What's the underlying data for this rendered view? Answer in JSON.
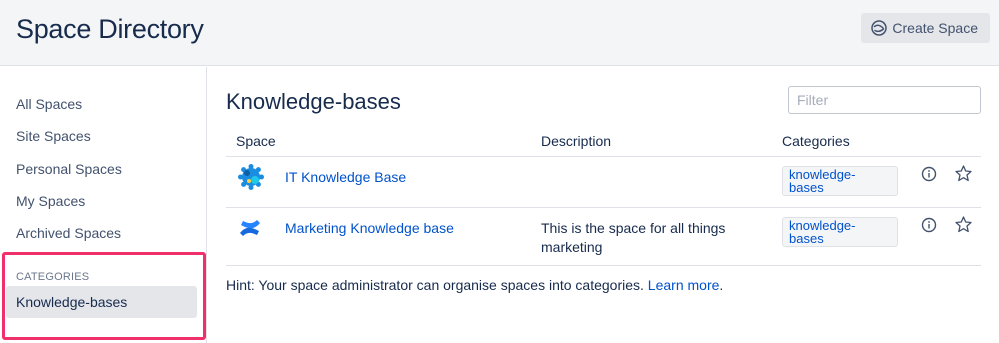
{
  "header": {
    "title": "Space Directory",
    "create_label": "Create Space"
  },
  "sidebar": {
    "items": [
      {
        "label": "All Spaces"
      },
      {
        "label": "Site Spaces"
      },
      {
        "label": "Personal Spaces"
      },
      {
        "label": "My Spaces"
      },
      {
        "label": "Archived Spaces"
      }
    ],
    "categories_heading": "CATEGORIES",
    "categories": [
      {
        "label": "Knowledge-bases",
        "selected": true
      }
    ]
  },
  "main": {
    "title": "Knowledge-bases",
    "filter_placeholder": "Filter",
    "columns": [
      "Space",
      "Description",
      "Categories"
    ],
    "rows": [
      {
        "icon": "it-knowledge-base-logo-icon",
        "name": "IT Knowledge Base",
        "description": "",
        "category_line1": "knowledge-",
        "category_line2": "bases"
      },
      {
        "icon": "confluence-logo-icon",
        "name": "Marketing Knowledge base",
        "description_line1": "This is the space for all things",
        "description_line2": "marketing",
        "category_line1": "knowledge-",
        "category_line2": "bases"
      }
    ],
    "hint_text": "Hint: Your space administrator can organise spaces into categories.",
    "hint_link": "Learn more",
    "hint_end": "."
  },
  "colors": {
    "accent": "#0052cc",
    "text": "#172b4d",
    "header_bg": "#f4f5f7",
    "selected_bg": "#e4e6ea",
    "highlight": "#f0306a"
  }
}
